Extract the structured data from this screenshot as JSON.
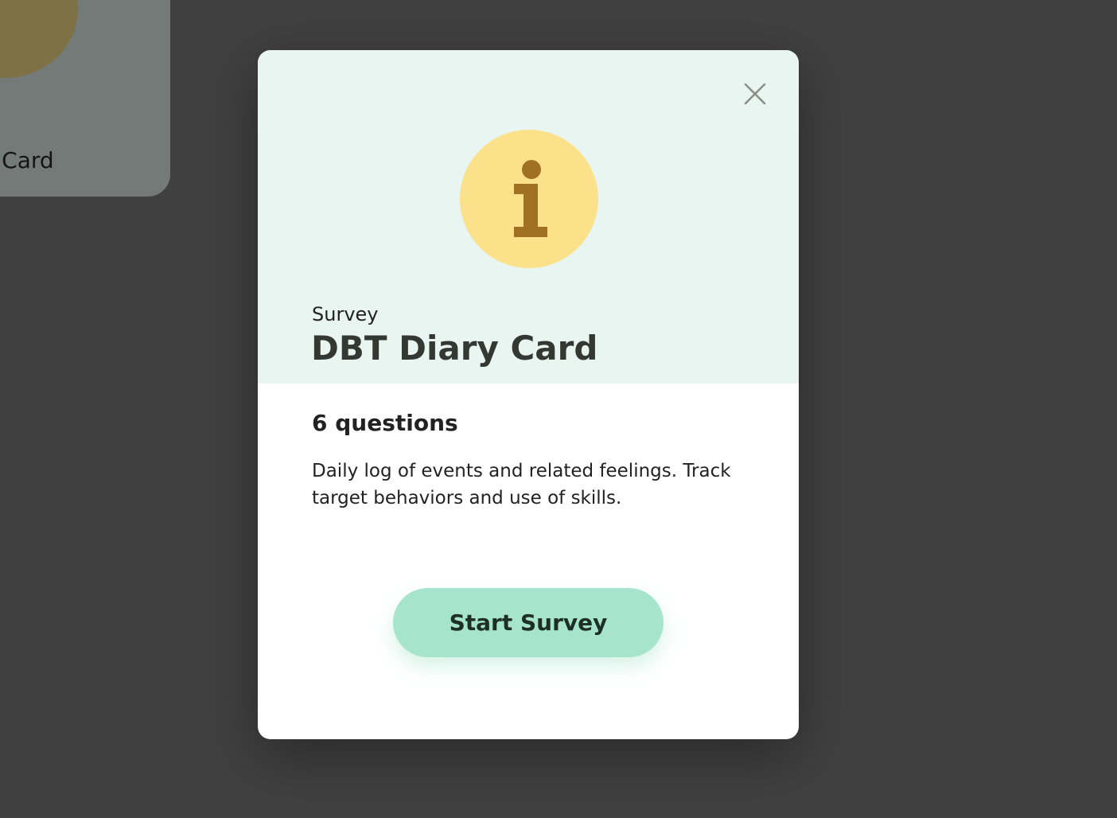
{
  "background": {
    "card_label": "ary Card",
    "card_icon": "info-icon"
  },
  "modal": {
    "close_icon": "close-icon",
    "badge_icon": "info-icon",
    "kind": "Survey",
    "title": "DBT Diary Card",
    "question_count": "6 questions",
    "description": "Daily log of events and related feelings. Track target behaviors and use of skills.",
    "start_button": "Start Survey"
  },
  "colors": {
    "header_bg": "#e9f5f0",
    "badge_bg": "#fbe28a",
    "badge_glyph": "#a07122",
    "button_bg": "#a6e4cd",
    "backdrop": "#808080"
  }
}
